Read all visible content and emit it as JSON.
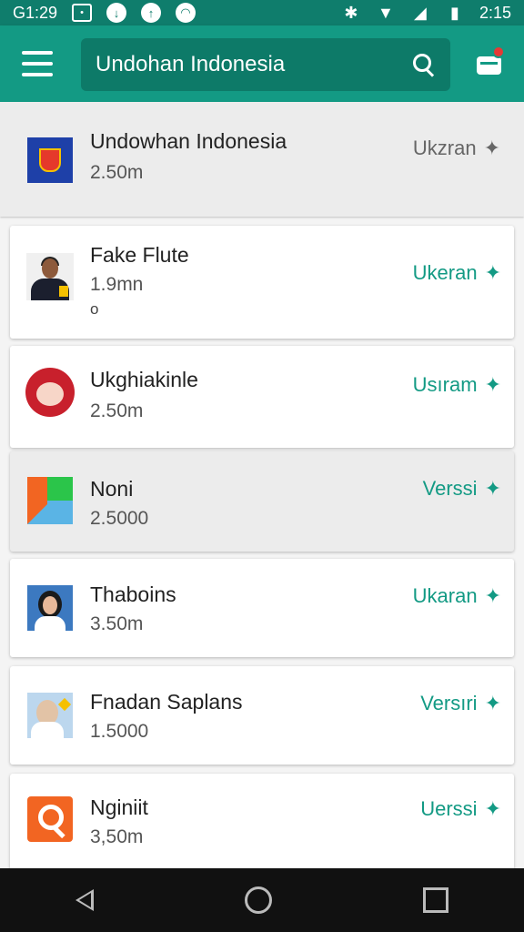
{
  "status_bar": {
    "time_left": "G1:29",
    "time_right": "2:15"
  },
  "app_bar": {
    "search_text": "Undohan Indonesia",
    "icons": [
      "menu-icon",
      "search-icon",
      "cart-icon"
    ]
  },
  "items": [
    {
      "title": "Undowhan Indonesia",
      "size": "2.50m",
      "subtag": "",
      "action": "Ukzran",
      "icon": "crest-icon"
    },
    {
      "title": "Fake Flute",
      "size": "1.9mn",
      "subtag": "o",
      "action": "Ukeran",
      "icon": "person-icon"
    },
    {
      "title": "Ukghiakinle",
      "size": "2.50m",
      "subtag": "",
      "action": "Usıram",
      "icon": "doll-icon"
    },
    {
      "title": "Noni",
      "size": "2.5000",
      "subtag": "",
      "action": "Verssi",
      "icon": "tiles-icon"
    },
    {
      "title": "Thaboins",
      "size": "3.50m",
      "subtag": "",
      "action": "Ukaran",
      "icon": "portrait-icon"
    },
    {
      "title": "Fnadan Saplans",
      "size": "1.5000",
      "subtag": "",
      "action": "Versıri",
      "icon": "portrait-icon"
    },
    {
      "title": "Nginiit",
      "size": "3,50m",
      "subtag": "",
      "action": "Uerssi",
      "icon": "magnify-icon"
    }
  ],
  "colors": {
    "accent": "#139a84",
    "status_bar": "#0f7d6c",
    "nav_bar": "#111111"
  }
}
